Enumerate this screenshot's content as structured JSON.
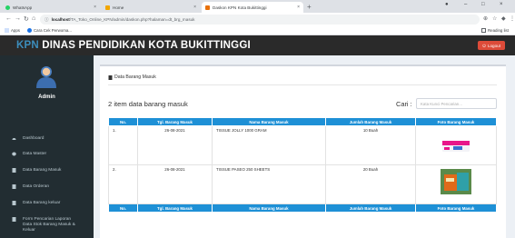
{
  "browser": {
    "tabs": [
      {
        "title": "WhatsApp",
        "icon": "whatsapp-icon",
        "color": "#25d366"
      },
      {
        "title": "Home",
        "icon": "home-page-icon",
        "color": "#f2a600"
      },
      {
        "title": "Daskon KPN Kota Bukittinggi",
        "icon": "site-icon",
        "color": "#e8710a"
      }
    ],
    "url_host": "localhost",
    "url_path": "/TA_Toko_Online_KPN/admin/daskon.php?halaman=dt_brg_masuk",
    "bookmarks": [
      {
        "label": "Apps",
        "icon": "apps-grid-icon"
      },
      {
        "label": "Cara Cek Perwoma...",
        "icon": "bookmark-favicon-icon"
      }
    ],
    "reading_list": "Reading list"
  },
  "header": {
    "brand_accent": "KPN",
    "brand_rest": " DINAS PENDIDIKAN KOTA BUKITTINGGI",
    "logout_label": "Logout",
    "accent_color": "#3c8dbc",
    "logout_color": "#dd4b39"
  },
  "sidebar": {
    "username": "Admin",
    "items": [
      {
        "label": "Dashboard",
        "icon": "dashboard-icon"
      },
      {
        "label": "Data Master",
        "icon": "database-icon"
      },
      {
        "label": "Data Barang Masuk",
        "icon": "file-icon"
      },
      {
        "label": "Data Orderan",
        "icon": "file-icon"
      },
      {
        "label": "Data Barang keluar",
        "icon": "file-icon"
      },
      {
        "label": "Form Pencarian Laporan Data Stok Barang Masuk & Keluar",
        "icon": "file-icon"
      }
    ]
  },
  "main": {
    "box_title": "Data Barang Masuk",
    "count_text": "2 item data barang masuk",
    "search_label": "Cari :",
    "search_placeholder": "Kata Kunci Pencarian...",
    "table_header_color": "#1e90d6",
    "columns": [
      "No.",
      "Tgl. Barang Masuk",
      "Nama Barang Masuk",
      "Jumlah Barang Masuk",
      "Foto Barang Masuk"
    ],
    "rows": [
      {
        "no": "1.",
        "tgl": "26-08-2021",
        "nama": "TISSUE JOLLY 1000 GRAM",
        "jumlah": "10 Buah",
        "foto": "tissue-jolly-product-photo"
      },
      {
        "no": "2.",
        "tgl": "26-08-2021",
        "nama": "TISSUE PASEO 250 SHEETS",
        "jumlah": "20 Buah",
        "foto": "tissue-paseo-product-photo"
      }
    ]
  }
}
